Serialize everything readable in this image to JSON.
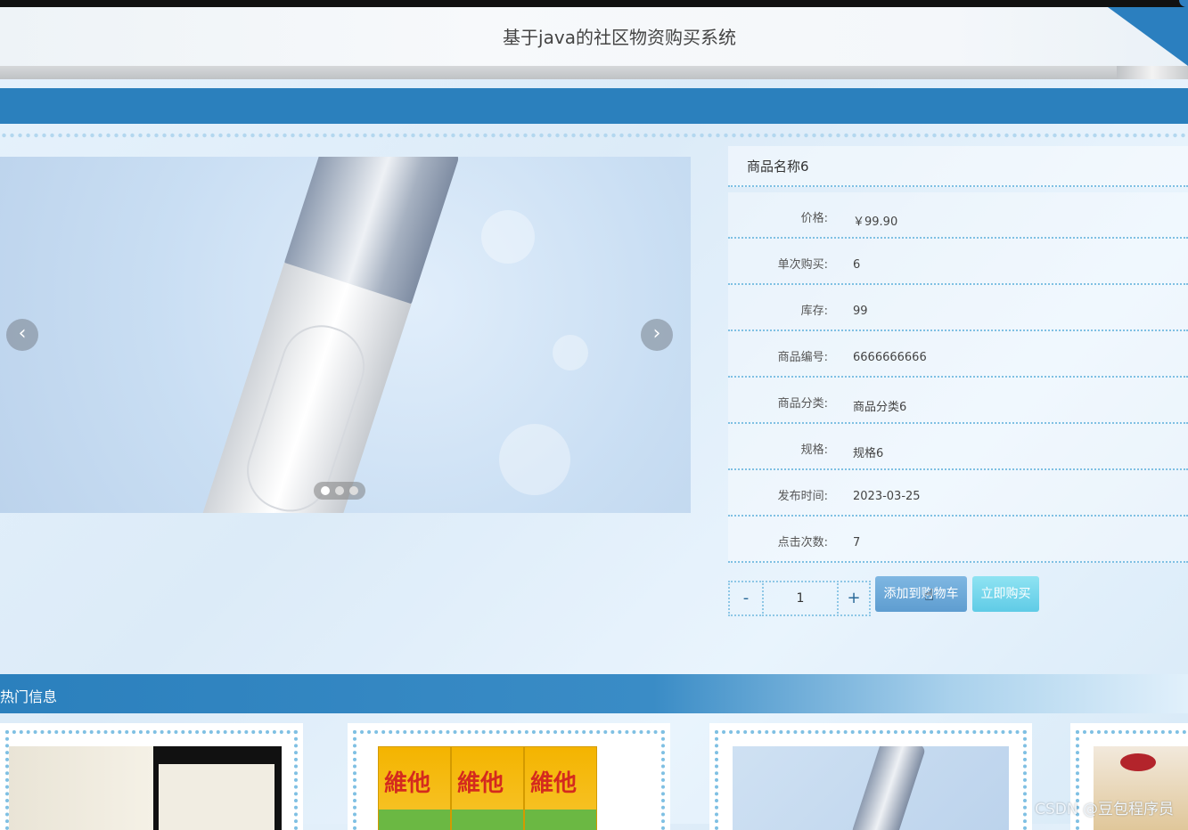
{
  "header": {
    "title": "基于java的社区物资购买系统"
  },
  "product": {
    "name": "商品名称6",
    "fields": [
      {
        "label": "价格:",
        "value": "￥99.90"
      },
      {
        "label": "单次购买:",
        "value": "6"
      },
      {
        "label": "库存:",
        "value": "99"
      },
      {
        "label": "商品编号:",
        "value": "6666666666"
      },
      {
        "label": "商品分类:",
        "value": "商品分类6"
      },
      {
        "label": "规格:",
        "value": "规格6"
      },
      {
        "label": "发布时间:",
        "value": "2023-03-25"
      },
      {
        "label": "点击次数:",
        "value": "7"
      }
    ]
  },
  "carousel": {
    "prev": "‹",
    "next": "›",
    "active_index": 1,
    "count": 3
  },
  "purchase": {
    "minus": "-",
    "plus": "+",
    "quantity": "1",
    "add_to_cart": "添加到购物车",
    "buy_now": "立即购买"
  },
  "hot": {
    "title": "热门信息"
  },
  "watermark": "CSDN @豆包程序员",
  "colors": {
    "primary": "#2b80bd",
    "dotted": "#7fc0e3"
  }
}
